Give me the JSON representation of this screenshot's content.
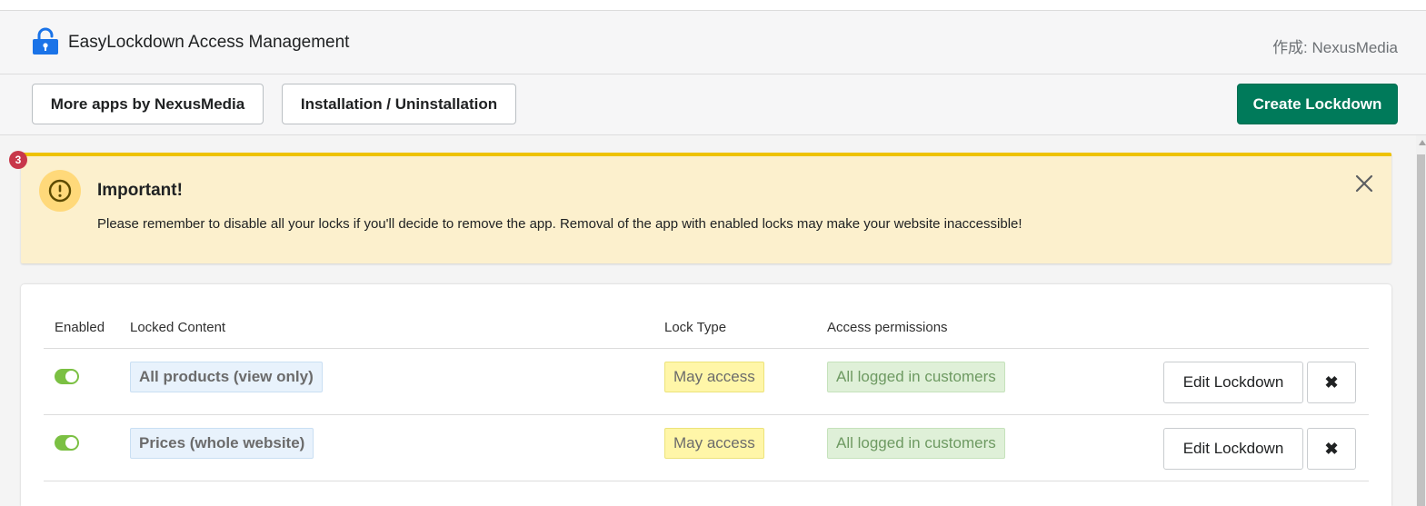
{
  "header": {
    "title": "EasyLockdown Access Management",
    "author": "作成: NexusMedia",
    "logo_icon": "padlock-icon",
    "logo_color": "#1a73e8"
  },
  "toolbar": {
    "more_apps_label": "More apps by NexusMedia",
    "install_label": "Installation / Uninstallation",
    "create_label": "Create Lockdown",
    "create_color": "#007a5a"
  },
  "notification_badge": "3",
  "banner": {
    "title": "Important!",
    "message": "Please remember to disable all your locks if you'll decide to remove the app. Removal of the app with enabled locks may make your website inaccessible!",
    "icon": "alert-circle-icon",
    "close_icon": "close-icon",
    "accent_color": "#eec200"
  },
  "table": {
    "headers": {
      "enabled": "Enabled",
      "content": "Locked Content",
      "type": "Lock Type",
      "permissions": "Access permissions"
    },
    "rows": [
      {
        "enabled": true,
        "content": "All products (view only)",
        "lock_type": "May access",
        "permissions": "All logged in customers",
        "edit_label": "Edit Lockdown",
        "delete_label": "✖"
      },
      {
        "enabled": true,
        "content": "Prices (whole website)",
        "lock_type": "May access",
        "permissions": "All logged in customers",
        "edit_label": "Edit Lockdown",
        "delete_label": "✖"
      }
    ]
  }
}
